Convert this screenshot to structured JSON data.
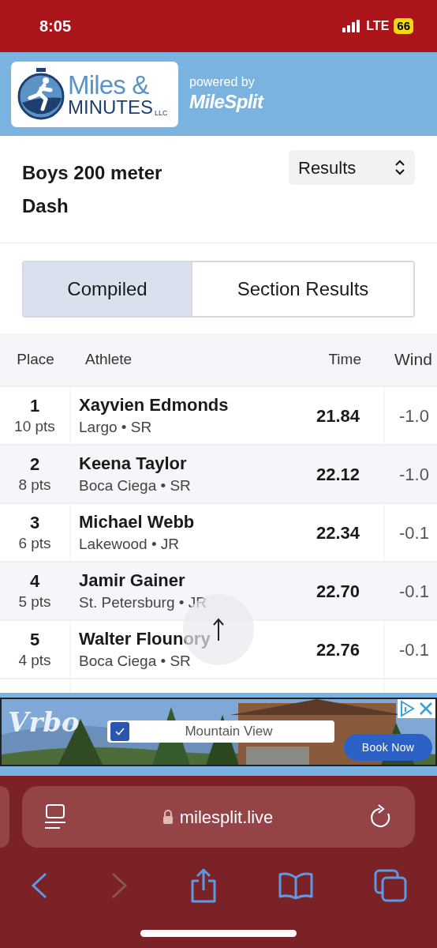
{
  "status_bar": {
    "time": "8:05",
    "network": "LTE",
    "battery": "66"
  },
  "header": {
    "logo_line_1": "Miles &",
    "logo_line_2": "MINUTES",
    "logo_suffix": "LLC",
    "powered_by": "powered by",
    "brand": "MileSplit"
  },
  "event": {
    "title": "Boys 200 meter Dash",
    "view_select": "Results"
  },
  "tabs": [
    {
      "label": "Compiled",
      "selected": true
    },
    {
      "label": "Section Results",
      "selected": false
    }
  ],
  "table": {
    "columns": [
      "Place",
      "Athlete",
      "Time",
      "Wind"
    ],
    "rows": [
      {
        "place": "1",
        "points": "10 pts",
        "athlete": "Xayvien Edmonds",
        "team": "Largo • SR",
        "time": "21.84",
        "wind": "-1.0"
      },
      {
        "place": "2",
        "points": "8 pts",
        "athlete": "Keena Taylor",
        "team": "Boca Ciega • SR",
        "time": "22.12",
        "wind": "-1.0"
      },
      {
        "place": "3",
        "points": "6 pts",
        "athlete": "Michael Webb",
        "team": "Lakewood • JR",
        "time": "22.34",
        "wind": "-0.1"
      },
      {
        "place": "4",
        "points": "5 pts",
        "athlete": "Jamir Gainer",
        "team": "St. Petersburg • JR",
        "time": "22.70",
        "wind": "-0.1"
      },
      {
        "place": "5",
        "points": "4 pts",
        "athlete": "Walter Flounory",
        "team": "Boca Ciega • SR",
        "time": "22.76",
        "wind": "-0.1"
      }
    ]
  },
  "ad": {
    "brand": "Vrbo",
    "checkbox_label": "Mountain View",
    "checked": true,
    "button": "Book Now"
  },
  "browser": {
    "url": "milesplit.live"
  }
}
